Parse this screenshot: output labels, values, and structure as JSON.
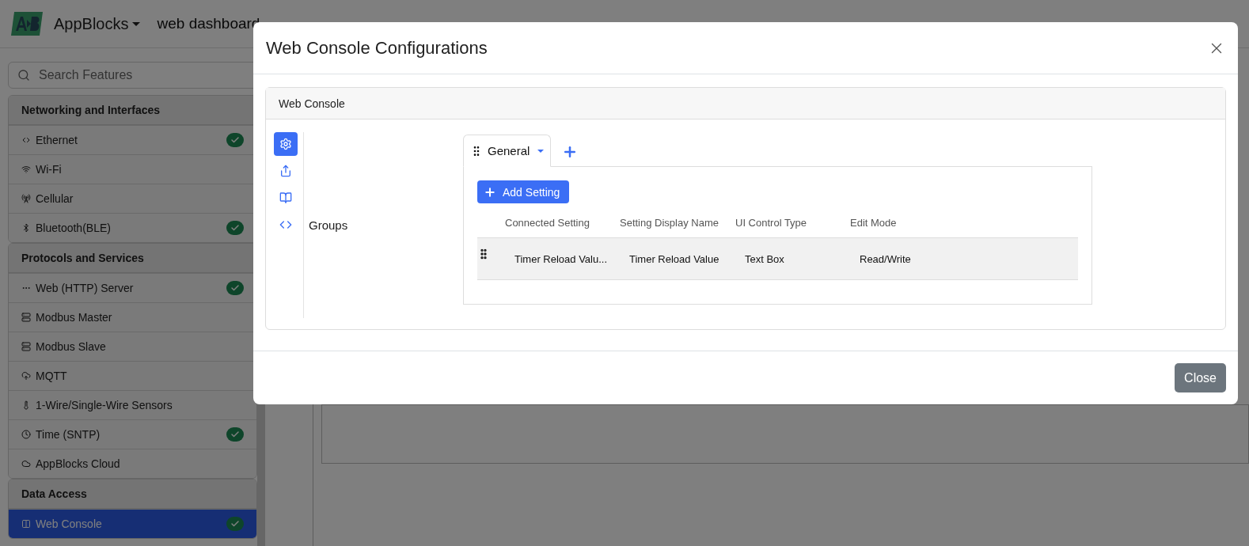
{
  "app_header": {
    "brand": "AppBlocks",
    "project_title": "web dashboard"
  },
  "sidebar": {
    "search": {
      "placeholder": "Search Features"
    },
    "sections": [
      {
        "title": "Networking and Interfaces",
        "items": [
          {
            "label": "Ethernet",
            "kind": "ethernet",
            "enabled": true,
            "selected": false
          },
          {
            "label": "Wi-Fi",
            "kind": "wifi",
            "enabled": false,
            "selected": false
          },
          {
            "label": "Cellular",
            "kind": "cellular",
            "enabled": false,
            "selected": false
          },
          {
            "label": "Bluetooth(BLE)",
            "kind": "bluetooth",
            "enabled": true,
            "selected": false
          }
        ]
      },
      {
        "title": "Protocols and Services",
        "items": [
          {
            "label": "Web (HTTP) Server",
            "kind": "web",
            "enabled": true,
            "selected": false
          },
          {
            "label": "Modbus Master",
            "kind": "modbus",
            "enabled": false,
            "selected": false
          },
          {
            "label": "Modbus Slave",
            "kind": "modbus",
            "enabled": false,
            "selected": false
          },
          {
            "label": "MQTT",
            "kind": "mqtt",
            "enabled": false,
            "selected": false
          },
          {
            "label": "1-Wire/Single-Wire Sensors",
            "kind": "sensor",
            "enabled": false,
            "selected": false
          },
          {
            "label": "Time (SNTP)",
            "kind": "time",
            "enabled": true,
            "selected": false
          },
          {
            "label": "AppBlocks Cloud",
            "kind": "cloud",
            "enabled": false,
            "selected": false
          }
        ]
      },
      {
        "title": "Data Access",
        "items": [
          {
            "label": "Web Console",
            "kind": "console",
            "enabled": true,
            "selected": true
          }
        ]
      }
    ]
  },
  "modal": {
    "title": "Web Console Configurations",
    "card_title": "Web Console",
    "side_tools": [
      {
        "kind": "settings",
        "selected": true
      },
      {
        "kind": "share",
        "selected": false
      },
      {
        "kind": "book",
        "selected": false
      },
      {
        "kind": "code",
        "selected": false
      }
    ],
    "groups_label": "Groups",
    "tabs": [
      {
        "label": "General",
        "selected": true
      }
    ],
    "add_button": "Add Setting",
    "columns": [
      "Connected Setting",
      "Setting Display Name",
      "UI Control Type",
      "Edit Mode"
    ],
    "rows": [
      {
        "cells": [
          "Timer Reload Valu...",
          "Timer Reload Value",
          "Text Box",
          "Read/Write"
        ]
      }
    ],
    "footer_button": "Close"
  }
}
